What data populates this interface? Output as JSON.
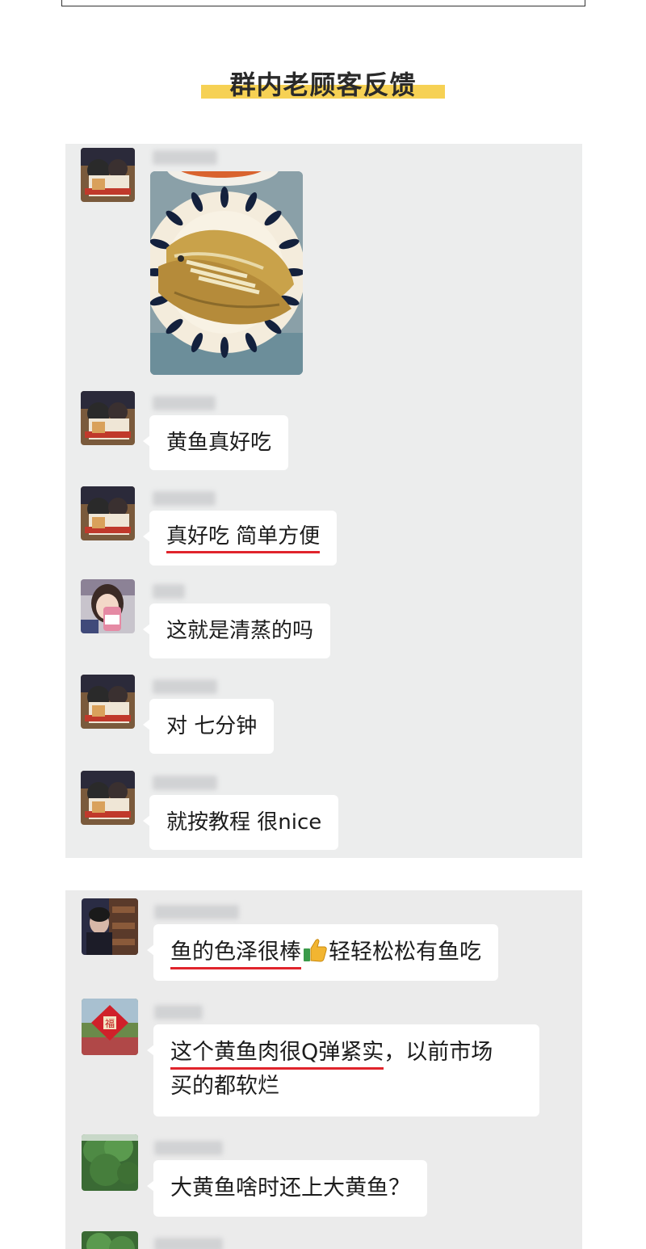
{
  "heading": {
    "title": "群内老顾客反馈"
  },
  "panel1": {
    "messages": [
      {
        "type": "image",
        "image_alt": "steamed-yellow-croaker-photo"
      },
      {
        "type": "text",
        "text": "黄鱼真好吃"
      },
      {
        "type": "text",
        "text_underlined": "真好吃 简单方便"
      },
      {
        "type": "text",
        "text": "这就是清蒸的吗"
      },
      {
        "type": "text",
        "text": "对 七分钟"
      },
      {
        "type": "text",
        "text": "就按教程 很nice"
      }
    ]
  },
  "panel2": {
    "messages": [
      {
        "underlined": "鱼的色泽很棒",
        "emoji": "thumbs-up-icon",
        "rest": "轻轻松松有鱼吃"
      },
      {
        "underlined": "这个黄鱼肉很Q弹紧实",
        "rest": "，以前市场",
        "line2": "买的都软烂"
      },
      {
        "text": "大黄鱼啥时还上大黄鱼？"
      }
    ]
  },
  "colors": {
    "accent_bar": "#f6d154",
    "underline": "#e0242c",
    "chat_bg": "#eceded"
  }
}
